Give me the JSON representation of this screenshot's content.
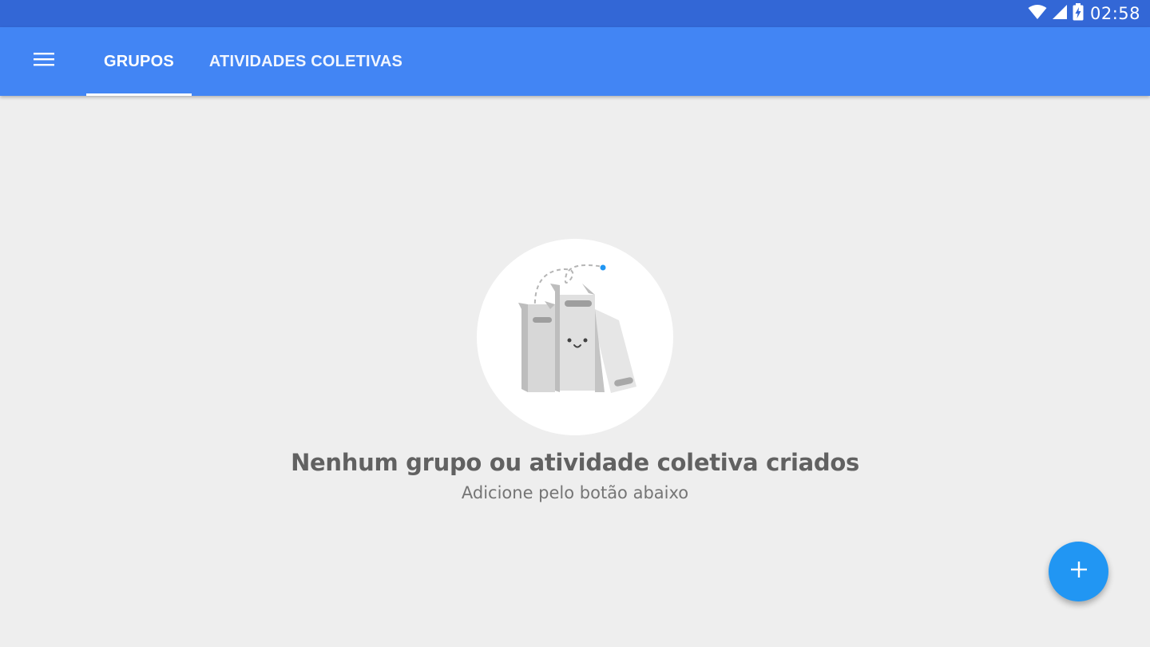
{
  "status_bar": {
    "time": "02:58",
    "icons": [
      "wifi-icon",
      "signal-icon",
      "battery-charging-icon"
    ],
    "color": "#3367d6"
  },
  "app_bar": {
    "color": "#4285f4",
    "menu_icon": "hamburger-menu-icon",
    "tabs": [
      {
        "label": "GRUPOS",
        "selected": true
      },
      {
        "label": "ATIVIDADES COLETIVAS",
        "selected": false
      }
    ]
  },
  "empty_state": {
    "illustration": "binders-illustration",
    "title": "Nenhum grupo ou atividade coletiva criados",
    "subtitle": "Adicione pelo botão abaixo"
  },
  "fab": {
    "icon": "plus-icon",
    "color": "#2196f3"
  }
}
